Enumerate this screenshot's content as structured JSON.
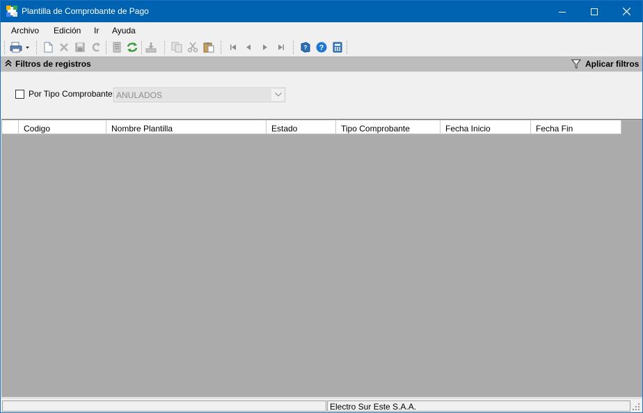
{
  "window": {
    "title": "Plantilla de Comprobante de Pago"
  },
  "menu": {
    "items": [
      "Archivo",
      "Edición",
      "Ir",
      "Ayuda"
    ]
  },
  "toolbar": {
    "icons": [
      "print-icon",
      "new-icon",
      "delete-icon",
      "save-icon",
      "undo-icon",
      "print-preview-icon",
      "refresh-icon",
      "import-icon",
      "copy-icon",
      "cut-icon",
      "paste-icon",
      "first-icon",
      "previous-icon",
      "next-icon",
      "last-icon",
      "book-help-icon",
      "help-icon",
      "calculator-icon"
    ]
  },
  "filters": {
    "title": "Filtros de registros",
    "apply_label": "Aplicar filtros",
    "tipo_label": "Por Tipo Comprobante:",
    "tipo_value": "ANULADOS",
    "tipo_checked": false
  },
  "grid": {
    "columns": [
      "Codigo",
      "Nombre Plantilla",
      "Estado",
      "Tipo Comprobante",
      "Fecha Inicio",
      "Fecha Fin"
    ],
    "rows": []
  },
  "status": {
    "company": "Electro Sur Este S.A.A."
  },
  "colors": {
    "titlebar": "#0063b1",
    "grid_background": "#ababab",
    "filter_header": "#bdbdbd"
  }
}
